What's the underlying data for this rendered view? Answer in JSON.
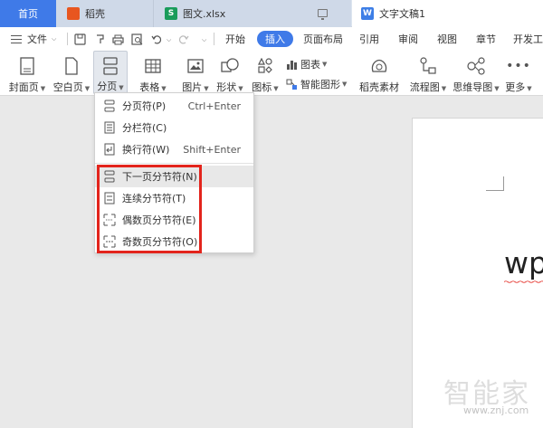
{
  "tabs": {
    "home": "首页",
    "doke": "稻壳",
    "xlsx": "图文.xlsx",
    "active_doc": "文字文稿1"
  },
  "menu": {
    "file": "文件",
    "start": "开始",
    "insert": "插入",
    "page_layout": "页面布局",
    "reference": "引用",
    "review": "审阅",
    "view": "视图",
    "section": "章节",
    "dev_tools": "开发工"
  },
  "ribbon": {
    "cover_page": "封面页",
    "blank_page": "空白页",
    "page_break": "分页",
    "table": "表格",
    "picture": "图片",
    "shape": "形状",
    "icon": "图标",
    "chart": "图表",
    "smart_shape": "智能图形",
    "doke_material": "稻壳素材",
    "flowchart": "流程图",
    "mindmap": "思维导图",
    "more": "更多"
  },
  "dropdown": {
    "items": [
      {
        "label": "分页符(P)",
        "shortcut": "Ctrl+Enter"
      },
      {
        "label": "分栏符(C)",
        "shortcut": ""
      },
      {
        "label": "换行符(W)",
        "shortcut": "Shift+Enter"
      },
      {
        "label": "下一页分节符(N)",
        "shortcut": ""
      },
      {
        "label": "连续分节符(T)",
        "shortcut": ""
      },
      {
        "label": "偶数页分节符(E)",
        "shortcut": ""
      },
      {
        "label": "奇数页分节符(O)",
        "shortcut": ""
      }
    ]
  },
  "document": {
    "text": "wp"
  },
  "watermark": {
    "brand": "智能家",
    "url": "www.znj.com"
  },
  "colors": {
    "accent": "#3f7ae8",
    "highlight_box": "#e3241c"
  }
}
